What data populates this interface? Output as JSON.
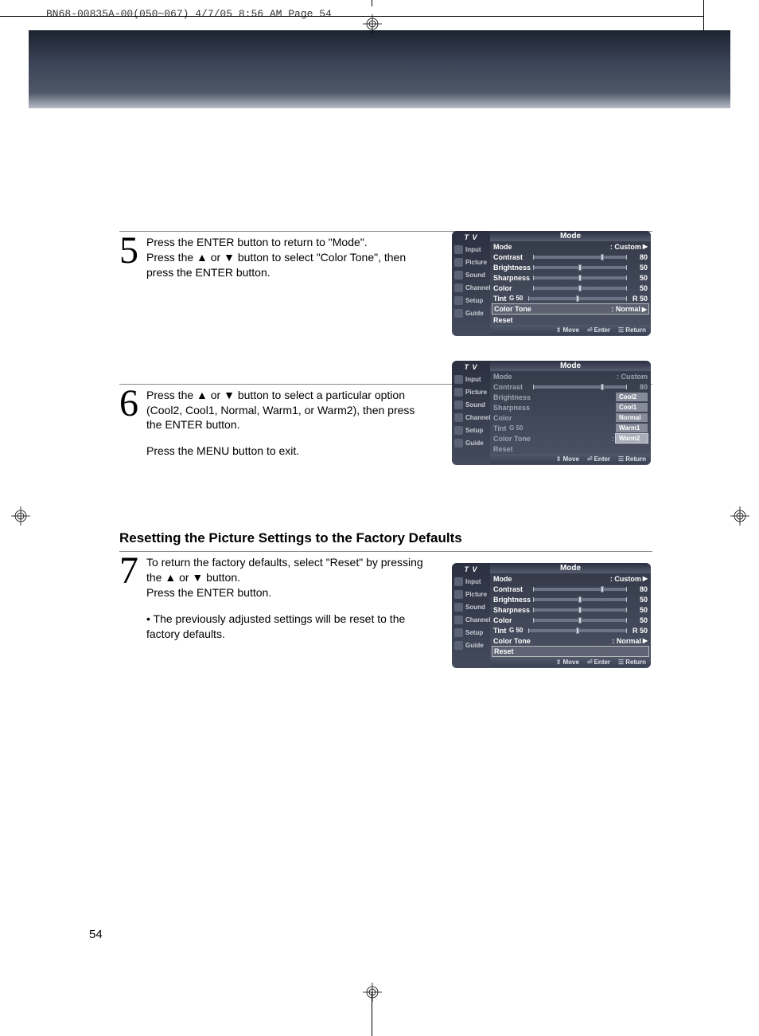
{
  "print_header": "BN68-00835A-00(050~067)  4/7/05  8:56 AM  Page 54",
  "page_number": "54",
  "section_heading": "Resetting the Picture Settings to the Factory Defaults",
  "steps": {
    "s5": {
      "num": "5",
      "p1": "Press the ENTER button to return to \"Mode\".",
      "p2": "Press the ▲ or ▼ button to select \"Color Tone\", then press the ENTER button."
    },
    "s6": {
      "num": "6",
      "p1": "Press the ▲ or ▼ button to select a particular option (Cool2, Cool1, Normal, Warm1, or Warm2), then press the ENTER button.",
      "p2": "Press the MENU button to exit."
    },
    "s7": {
      "num": "7",
      "p1": "To return the factory defaults, select \"Reset\" by pressing the ▲ or ▼ button.",
      "p2": "Press the ENTER button.",
      "bullet": "• The previously adjusted settings will be reset to the factory defaults."
    }
  },
  "osd": {
    "tv_label": "T V",
    "sidebar": [
      "Input",
      "Picture",
      "Sound",
      "Channel",
      "Setup",
      "Guide"
    ],
    "title": "Mode",
    "rows": {
      "mode": "Mode",
      "contrast": "Contrast",
      "brightness": "Brightness",
      "sharpness": "Sharpness",
      "color": "Color",
      "tint": "Tint",
      "tint_g": "G 50",
      "tint_r": "R 50",
      "colortone": "Color Tone",
      "reset": "Reset"
    },
    "values": {
      "mode": ": Custom",
      "contrast": "80",
      "brightness": "50",
      "sharpness": "50",
      "color": "50",
      "colortone": ": Normal"
    },
    "options": [
      "Cool2",
      "Cool1",
      "Normal",
      "Warm1",
      "Warm2"
    ],
    "footer": {
      "move": "Move",
      "enter": "Enter",
      "return": "Return"
    }
  }
}
